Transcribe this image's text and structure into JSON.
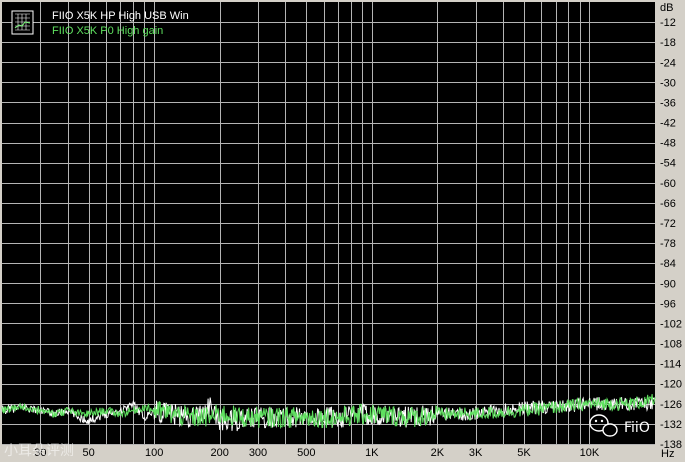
{
  "chart_data": {
    "type": "line",
    "xscale": "log",
    "xlim": [
      20,
      20000
    ],
    "ylim": [
      -138,
      -6
    ],
    "ylabel": "dB",
    "xlabel": "Hz",
    "background": "#000000",
    "grid": true,
    "grid_color": "#b4b4b4",
    "x_tick_values": [
      30,
      50,
      100,
      200,
      300,
      500,
      1000,
      2000,
      3000,
      5000,
      10000
    ],
    "x_tick_labels": [
      "30",
      "50",
      "100",
      "200",
      "300",
      "500",
      "1K",
      "2K",
      "3K",
      "5K",
      "10K"
    ],
    "y_tick_values": [
      -12,
      -18,
      -24,
      -30,
      -36,
      -42,
      -48,
      -54,
      -60,
      -66,
      -72,
      -78,
      -84,
      -90,
      -96,
      -102,
      -108,
      -114,
      -120,
      -126,
      -132,
      -138
    ],
    "y_tick_labels": [
      "-12",
      "-18",
      "-24",
      "-30",
      "-36",
      "-42",
      "-48",
      "-54",
      "-60",
      "-66",
      "-72",
      "-78",
      "-84",
      "-90",
      "-96",
      "-102",
      "-108",
      "-114",
      "-120",
      "-126",
      "-132",
      "-138"
    ],
    "legend_position": "top-left",
    "series": [
      {
        "name": "FIIO X5K HP High USB Win",
        "color": "#ffffff",
        "x": [
          20,
          25,
          30,
          35,
          40,
          45,
          50,
          60,
          70,
          80,
          90,
          100,
          120,
          150,
          180,
          200,
          250,
          300,
          400,
          500,
          700,
          1000,
          1500,
          2000,
          3000,
          5000,
          7000,
          10000,
          15000,
          20000
        ],
        "y": [
          -128,
          -127,
          -128,
          -129,
          -128,
          -130,
          -131,
          -129,
          -128,
          -126,
          -130,
          -128,
          -129,
          -130,
          -127,
          -131,
          -131,
          -130,
          -130,
          -130,
          -130,
          -129,
          -130,
          -129,
          -129,
          -127,
          -127,
          -126,
          -126,
          -126
        ]
      },
      {
        "name": "FIIO X5K P0 High gain",
        "color": "#5fe05f",
        "x": [
          20,
          25,
          30,
          35,
          40,
          45,
          50,
          60,
          70,
          80,
          90,
          100,
          120,
          150,
          180,
          200,
          250,
          300,
          400,
          500,
          700,
          1000,
          1500,
          2000,
          3000,
          5000,
          7000,
          10000,
          15000,
          20000
        ],
        "y": [
          -128,
          -127,
          -128,
          -129,
          -128,
          -129,
          -129,
          -128,
          -129,
          -128,
          -127,
          -128,
          -129,
          -130,
          -130,
          -129,
          -130,
          -130,
          -130,
          -130,
          -130,
          -129,
          -130,
          -129,
          -129,
          -128,
          -127,
          -126,
          -126,
          -125
        ]
      }
    ]
  },
  "watermark": {
    "right": "FiiO",
    "left": "小耳朵评测"
  }
}
